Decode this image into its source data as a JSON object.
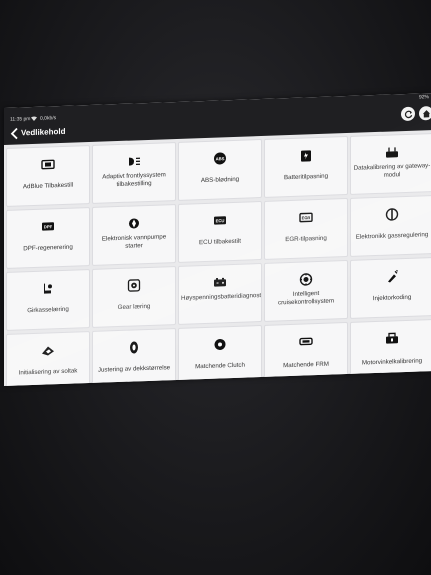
{
  "status_bar": {
    "time": "11:35 pm",
    "speed": "0,0kb/s",
    "battery": "92%"
  },
  "header": {
    "title": "Vedlikehold",
    "back_icon": "chevron-left-icon",
    "right_icons": [
      "refresh-icon",
      "home-icon"
    ]
  },
  "tiles": [
    {
      "label": "AdBlue Tilbakestill",
      "icon": "adblue-icon"
    },
    {
      "label": "Adaptivt frontlyssystem tilbakestilling",
      "icon": "headlight-icon"
    },
    {
      "label": "ABS-blødning",
      "icon": "abs-icon"
    },
    {
      "label": "Batteritilpasning",
      "icon": "battery-icon"
    },
    {
      "label": "Datakalibrering av gateway-modul",
      "icon": "gateway-icon"
    },
    {
      "label": "DPF-regenerering",
      "icon": "dpf-icon"
    },
    {
      "label": "Elektronisk vannpumpe starter",
      "icon": "water-pump-icon"
    },
    {
      "label": "ECU tilbakestilt",
      "icon": "ecu-icon"
    },
    {
      "label": "EGR-tilpasning",
      "icon": "egr-icon"
    },
    {
      "label": "Elektronikk gassregulering",
      "icon": "throttle-icon"
    },
    {
      "label": "Girkasselæring",
      "icon": "gearbox-icon"
    },
    {
      "label": "Gear læring",
      "icon": "gear-learning-icon"
    },
    {
      "label": "Høyspenningsbatteridiagnostikk",
      "icon": "hv-battery-icon"
    },
    {
      "label": "Intelligent cruisekontrollsystem",
      "icon": "cruise-control-icon"
    },
    {
      "label": "Injektorkoding",
      "icon": "injector-icon"
    },
    {
      "label": "Initialisering av soltak",
      "icon": "sunroof-icon"
    },
    {
      "label": "Justering av dekkstørrelse",
      "icon": "tire-icon"
    },
    {
      "label": "Matchende Clutch",
      "icon": "clutch-icon"
    },
    {
      "label": "Matchende FRM",
      "icon": "frm-icon"
    },
    {
      "label": "Motorvinkelkalibrering",
      "icon": "engine-angle-icon"
    }
  ]
}
